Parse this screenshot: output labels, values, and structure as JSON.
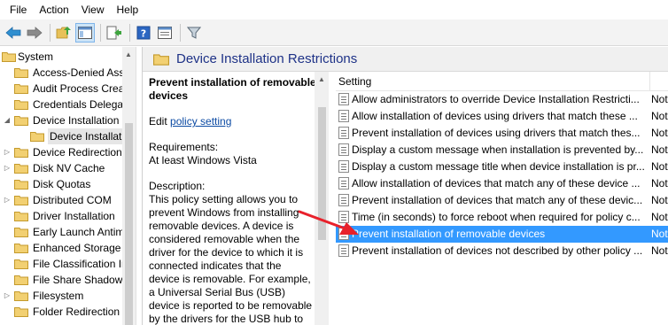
{
  "menu": [
    "File",
    "Action",
    "View",
    "Help"
  ],
  "toolbar": {
    "icons": [
      "back-arrow-icon",
      "forward-arrow-icon",
      "up-folder-icon",
      "show-hide-tree-icon",
      "export-list-icon",
      "help-icon",
      "properties-icon",
      "filter-icon"
    ]
  },
  "tree": {
    "items": [
      {
        "label": "System",
        "expander": "expanded"
      },
      {
        "label": "Access-Denied Assi",
        "expander": "none"
      },
      {
        "label": "Audit Process Creat",
        "expander": "none"
      },
      {
        "label": "Credentials Delegat",
        "expander": "none"
      },
      {
        "label": "Device Installation",
        "expander": "expanded"
      },
      {
        "label": "Device Installati",
        "expander": "none"
      },
      {
        "label": "Device Redirection",
        "expander": "collapsed"
      },
      {
        "label": "Disk NV Cache",
        "expander": "collapsed"
      },
      {
        "label": "Disk Quotas",
        "expander": "none"
      },
      {
        "label": "Distributed COM",
        "expander": "collapsed"
      },
      {
        "label": "Driver Installation",
        "expander": "none"
      },
      {
        "label": "Early Launch Antim",
        "expander": "none"
      },
      {
        "label": "Enhanced Storage A",
        "expander": "none"
      },
      {
        "label": "File Classification Ir",
        "expander": "none"
      },
      {
        "label": "File Share Shadow C",
        "expander": "none"
      },
      {
        "label": "Filesystem",
        "expander": "collapsed"
      },
      {
        "label": "Folder Redirection",
        "expander": "none"
      }
    ]
  },
  "header": {
    "title": "Device Installation Restrictions"
  },
  "description": {
    "policy_title": "Prevent installation of removable devices",
    "edit_prefix": "Edit ",
    "edit_link": "policy setting",
    "requirements_label": "Requirements:",
    "requirements_value": "At least Windows Vista",
    "description_label": "Description:",
    "description_text": "This policy setting allows you to prevent Windows from installing removable devices. A device is considered removable when the driver for the device to which it is connected indicates that the device is removable. For example, a Universal Serial Bus (USB) device is reported to be removable by the drivers for the USB hub to which"
  },
  "list": {
    "column_setting": "Setting",
    "rows": [
      {
        "name": "Allow administrators to override Device Installation Restricti...",
        "state": "Not"
      },
      {
        "name": "Allow installation of devices using drivers that match these ...",
        "state": "Not"
      },
      {
        "name": "Prevent installation of devices using drivers that match thes...",
        "state": "Not"
      },
      {
        "name": "Display a custom message when installation is prevented by...",
        "state": "Not"
      },
      {
        "name": "Display a custom message title when device installation is pr...",
        "state": "Not"
      },
      {
        "name": "Allow installation of devices that match any of these device ...",
        "state": "Not"
      },
      {
        "name": "Prevent installation of devices that match any of these devic...",
        "state": "Not"
      },
      {
        "name": "Time (in seconds) to force reboot when required for policy c...",
        "state": "Not"
      },
      {
        "name": "Prevent installation of removable devices",
        "state": "Not",
        "selected": true
      },
      {
        "name": "Prevent installation of devices not described by other policy ...",
        "state": "Not"
      }
    ]
  },
  "colors": {
    "selection": "#3399ff",
    "annotation_arrow": "#e8212b",
    "header_title": "#1e3287"
  }
}
